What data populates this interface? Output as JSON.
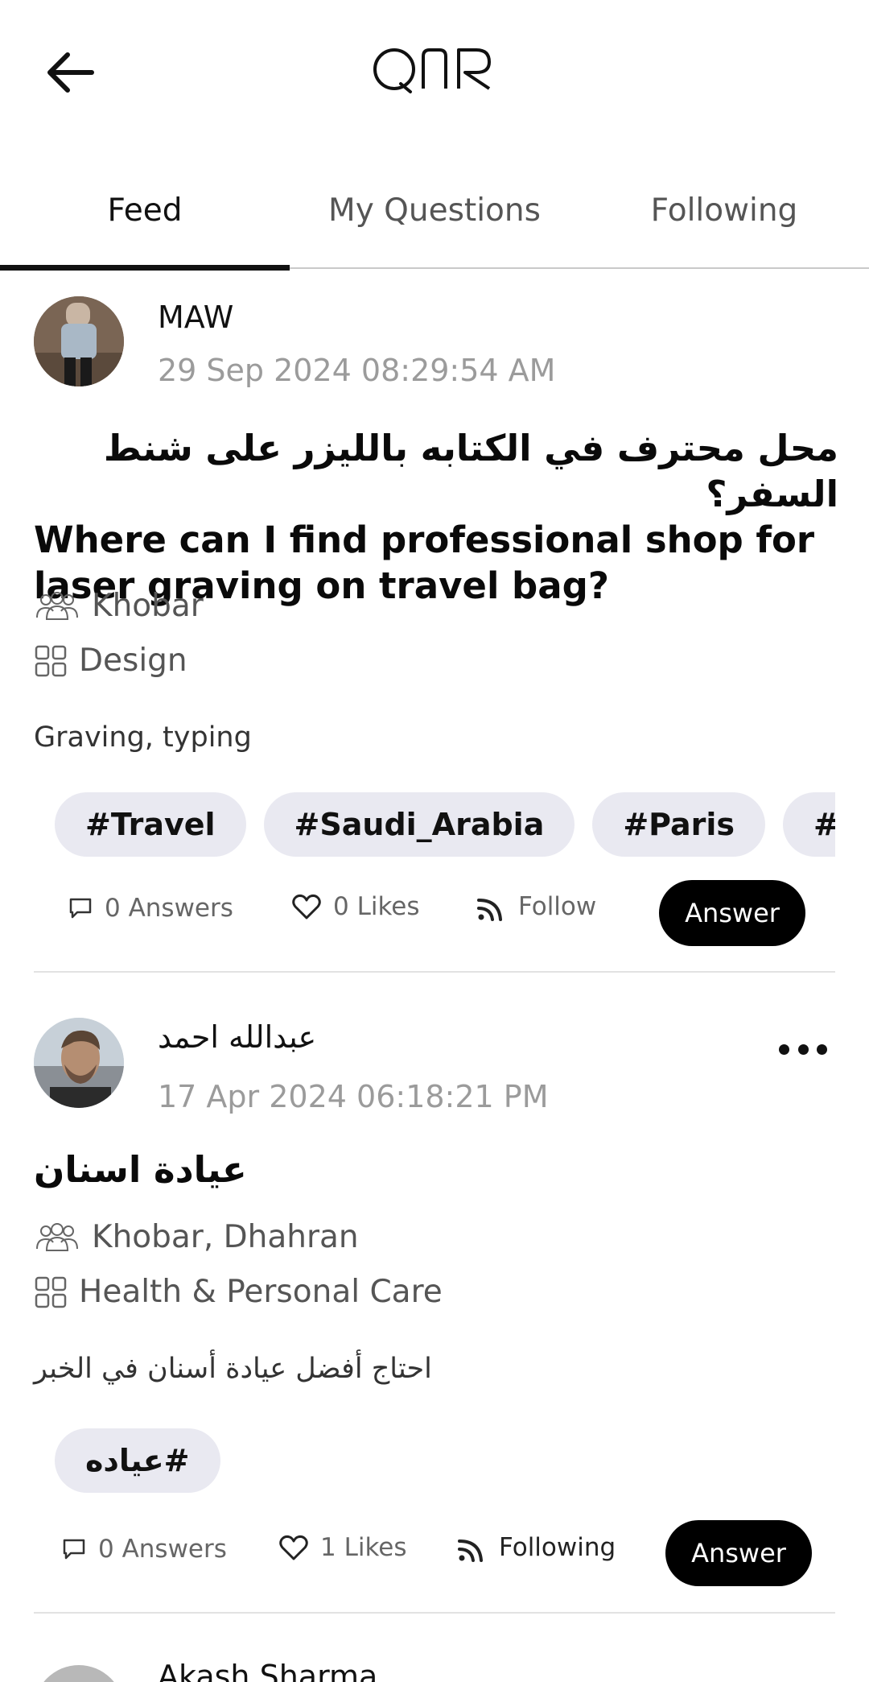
{
  "header": {
    "back_icon": "arrow-left-icon",
    "logo_text": "QNR"
  },
  "tabs": [
    {
      "label": "Feed",
      "active": true
    },
    {
      "label": "My Questions",
      "active": false
    },
    {
      "label": "Following",
      "active": false
    }
  ],
  "posts": [
    {
      "author": "MAW",
      "date": "29 Sep 2024 08:29:54 AM",
      "title_ar": "محل محترف في الكتابه بالليزر على شنط  السفر؟",
      "title_en": "Where can I find professional shop for laser graving on travel bag?",
      "location": "Khobar",
      "category": "Design",
      "description": "Graving, typing",
      "tags": [
        "#Travel",
        "#Saudi_Arabia",
        "#Paris",
        "#London"
      ],
      "answers_label": "0 Answers",
      "likes_label": "0 Likes",
      "follow_label": "Follow",
      "answer_button": "Answer"
    },
    {
      "author": "عبدالله احمد",
      "date": "17 Apr 2024 06:18:21 PM",
      "title": "عيادة اسنان",
      "location": "Khobar, Dhahran",
      "category": "Health & Personal Care",
      "description": "احتاج أفضل عيادة أسنان في الخبر",
      "tags": [
        "#عياده"
      ],
      "answers_label": "0 Answers",
      "likes_label": "1 Likes",
      "follow_label": "Following",
      "answer_button": "Answer"
    },
    {
      "author": "Akash Sharma"
    }
  ],
  "colors": {
    "accent": "#000000",
    "tag_bg": "#e9e9f1",
    "muted_text": "#9b9b9b"
  }
}
